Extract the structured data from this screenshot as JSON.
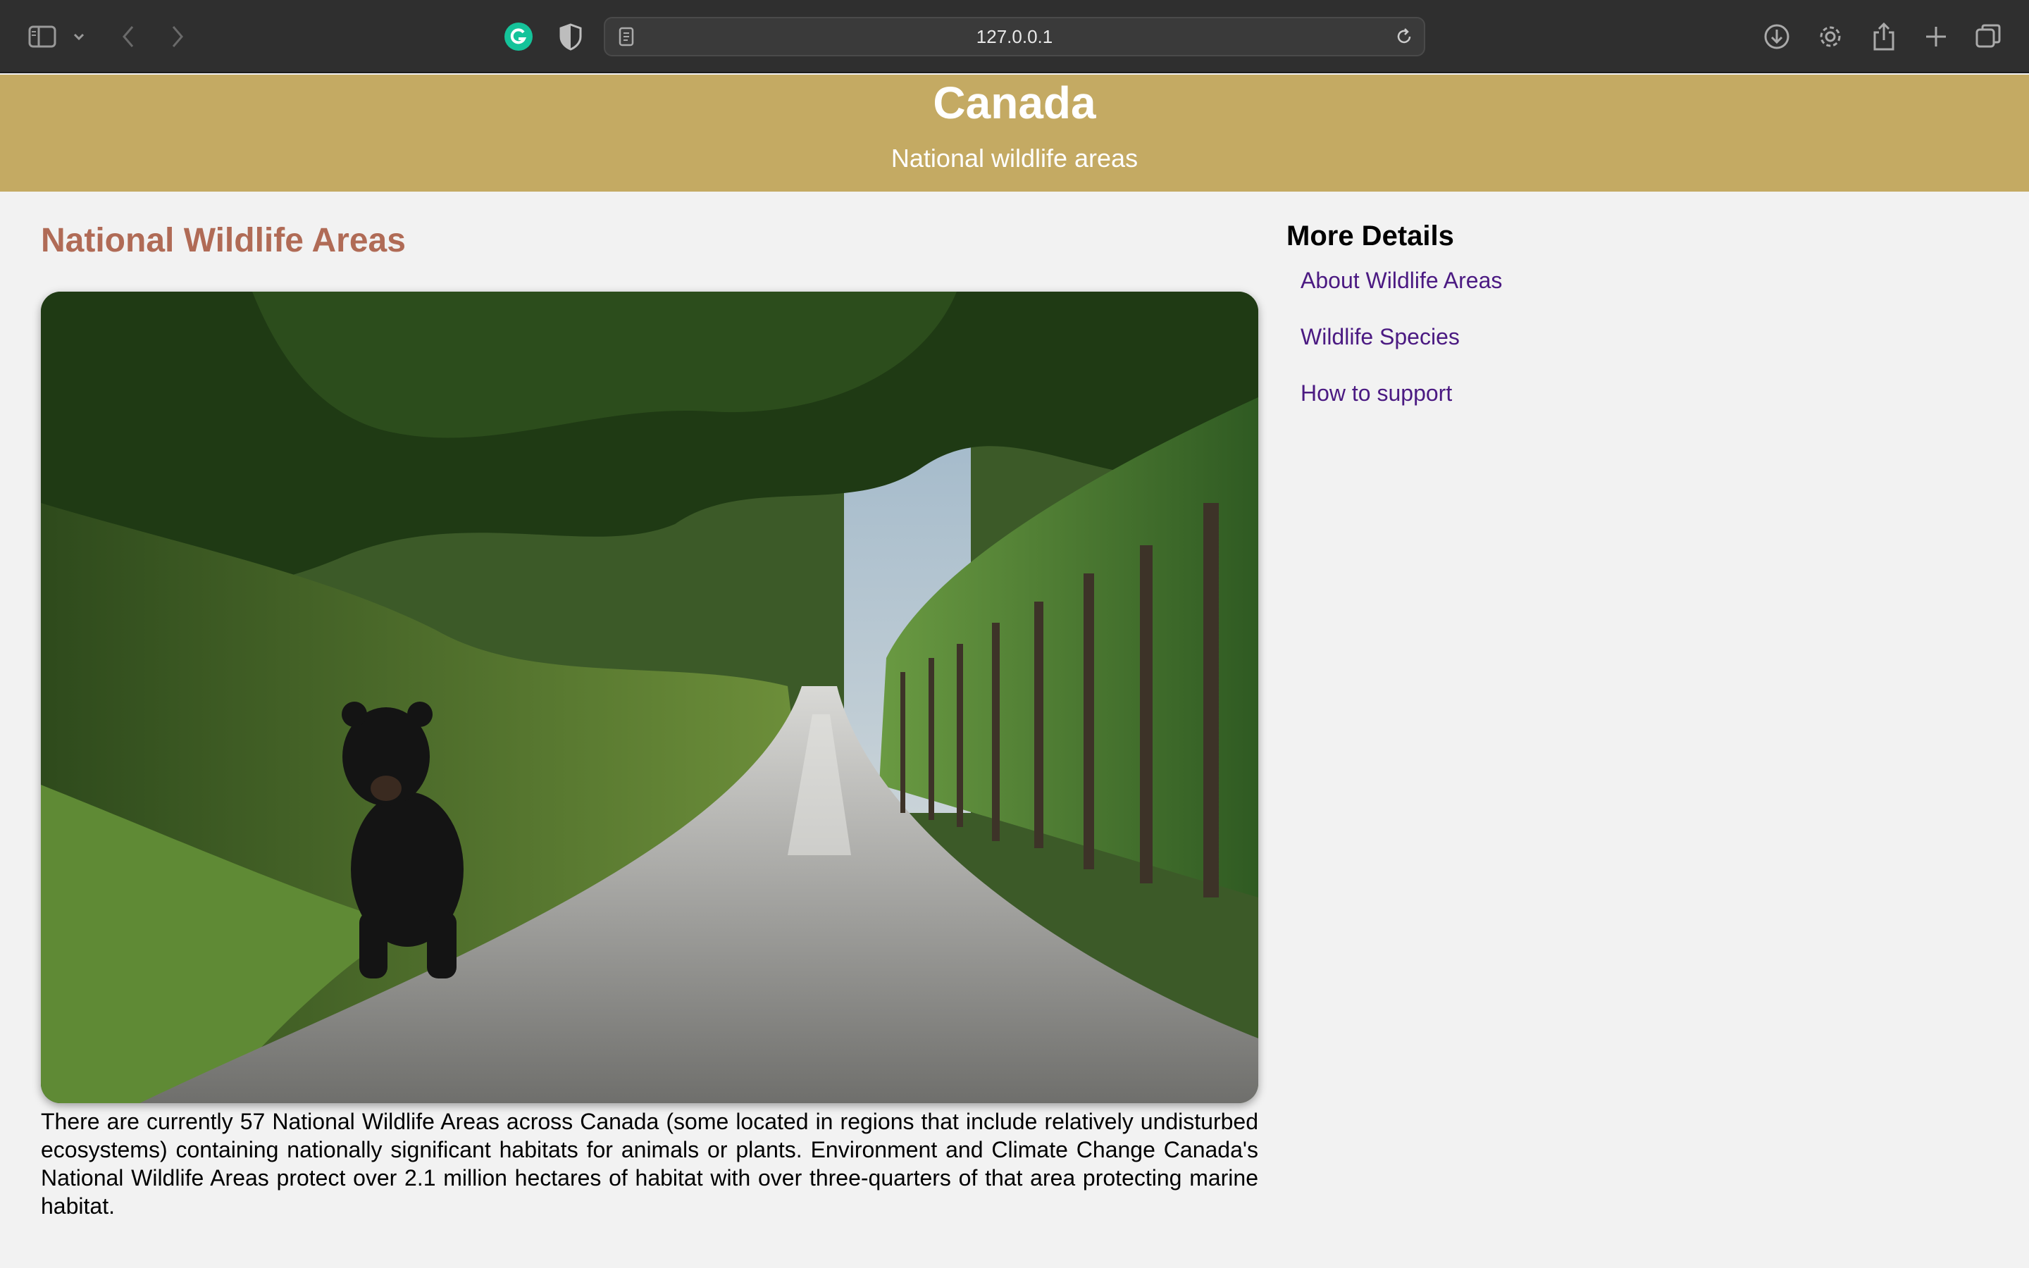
{
  "browser": {
    "url": "127.0.0.1",
    "icons": [
      "sidebar-icon",
      "chevron-down-icon",
      "back-icon",
      "forward-icon",
      "grammarly-icon",
      "shield-icon",
      "page-icon",
      "reload-icon",
      "download-icon",
      "gear-icon",
      "share-icon",
      "new-tab-icon",
      "tabs-overview-icon"
    ],
    "colors": {
      "chrome": "#2f2f2f",
      "urlbar": "#3a3a3a",
      "grammarly": "#15c39a"
    }
  },
  "header": {
    "title": "Canada",
    "subtitle": "National wildlife areas",
    "background": "#c4aa63"
  },
  "main": {
    "heading": "National Wildlife Areas",
    "heading_color": "#b06b56",
    "image_alt": "",
    "intro": "There are currently 57 National Wildlife Areas across Canada (some located in regions that include relatively undisturbed ecosystems) containing nationally significant habitats for animals or plants. Environment and Climate Change Canada's National Wildlife Areas protect over 2.1 million hectares of habitat with over three-quarters of that area protecting marine habitat."
  },
  "sidebar": {
    "heading": "More Details",
    "link_color": "#4b1a82",
    "links": [
      {
        "label": "About Wildlife Areas"
      },
      {
        "label": "Wildlife Species"
      },
      {
        "label": "How to support"
      }
    ]
  }
}
